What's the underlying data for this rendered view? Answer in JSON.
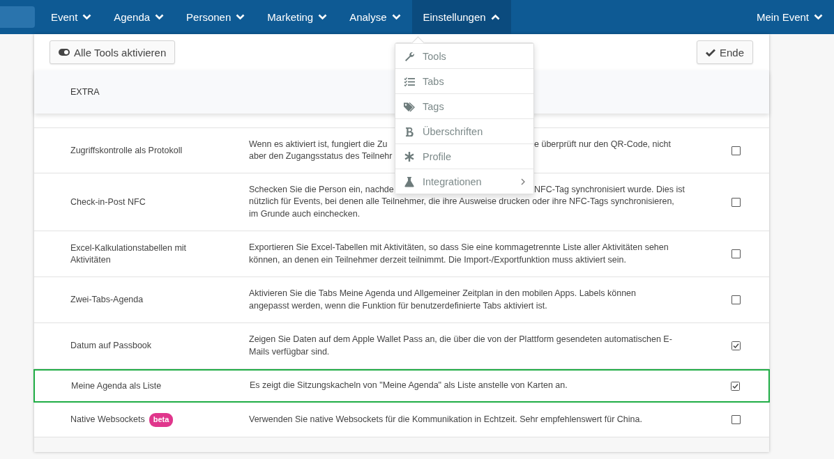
{
  "nav": {
    "items": [
      {
        "label": "Event",
        "selected": false,
        "expanded": false
      },
      {
        "label": "Agenda",
        "selected": false,
        "expanded": false
      },
      {
        "label": "Personen",
        "selected": false,
        "expanded": false
      },
      {
        "label": "Marketing",
        "selected": false,
        "expanded": false
      },
      {
        "label": "Analyse",
        "selected": false,
        "expanded": false
      },
      {
        "label": "Einstellungen",
        "selected": true,
        "expanded": true
      }
    ],
    "account": "Mein Event"
  },
  "toolbar": {
    "toggle_button": "Alle Tools aktivieren",
    "done_button": "Ende"
  },
  "section": "EXTRA",
  "menu": {
    "items": [
      {
        "label": "Tools",
        "kind": "wrench",
        "has_submenu": false
      },
      {
        "label": "Tabs",
        "kind": "checklist",
        "has_submenu": false
      },
      {
        "label": "Tags",
        "kind": "tags",
        "has_submenu": false
      },
      {
        "label": "Überschriften",
        "kind": "bold",
        "has_submenu": false
      },
      {
        "label": "Profile",
        "kind": "asterisk",
        "has_submenu": false
      },
      {
        "label": "Integrationen",
        "kind": "flask",
        "has_submenu": true
      }
    ]
  },
  "rows": [
    {
      "name": "Zugriffskontrolle als Protokoll",
      "description_lines": [
        [
          "Wenn es aktiviert ist, fungiert die Zu",
          "e überprüft nur den QR-Code, nicht"
        ],
        [
          "aber den Zugangsstatus des Teilnehr"
        ]
      ],
      "checked": false,
      "highlighted": false
    },
    {
      "name": "Check-in-Post NFC",
      "description_lines": [
        [
          "Schecken Sie die Person ein, nachde",
          "NFC-Tag synchronisiert wurde. Dies ist"
        ],
        [
          "nützlich für Events, bei denen alle Teilnehmer, die ihre Ausweise drucken oder ihre NFC-Tags synchronisieren,"
        ],
        [
          "im Grunde auch einchecken."
        ]
      ],
      "checked": false,
      "highlighted": false
    },
    {
      "name": "Excel-Kalkulationstabellen mit Aktivitäten",
      "description_lines": [
        [
          "Exportieren Sie Excel-Tabellen mit Aktivitäten, so dass Sie eine kommagetrennte Liste aller Aktivitäten sehen"
        ],
        [
          "können, an denen ein Teilnehmer derzeit teilnimmt. Die Import-/Exportfunktion muss aktiviert sein."
        ]
      ],
      "checked": false,
      "highlighted": false
    },
    {
      "name": "Zwei-Tabs-Agenda",
      "description_lines": [
        [
          "Aktivieren Sie die Tabs Meine Agenda und Allgemeiner Zeitplan in den mobilen Apps. Labels können"
        ],
        [
          "angepasst werden, wenn die Funktion für benutzerdefinierte Tabs aktiviert ist."
        ]
      ],
      "checked": false,
      "highlighted": false
    },
    {
      "name": "Datum auf Passbook",
      "description_lines": [
        [
          "Zeigen Sie Daten auf dem Apple Wallet Pass an, die über die von der Plattform gesendeten automatischen E-"
        ],
        [
          "Mails verfügbar sind."
        ]
      ],
      "checked": true,
      "highlighted": false
    },
    {
      "name": "Meine Agenda als Liste",
      "description_lines": [
        [
          "Es zeigt die Sitzungskacheln von \"Meine Agenda\" als Liste anstelle von Karten an."
        ]
      ],
      "checked": true,
      "highlighted": true
    },
    {
      "name": "Native Websockets",
      "badge": "beta",
      "description_lines": [
        [
          "Verwenden Sie native Websockets für die Kommunikation in Echtzeit. Sehr empfehlenswert für China."
        ]
      ],
      "checked": false,
      "highlighted": false
    }
  ]
}
